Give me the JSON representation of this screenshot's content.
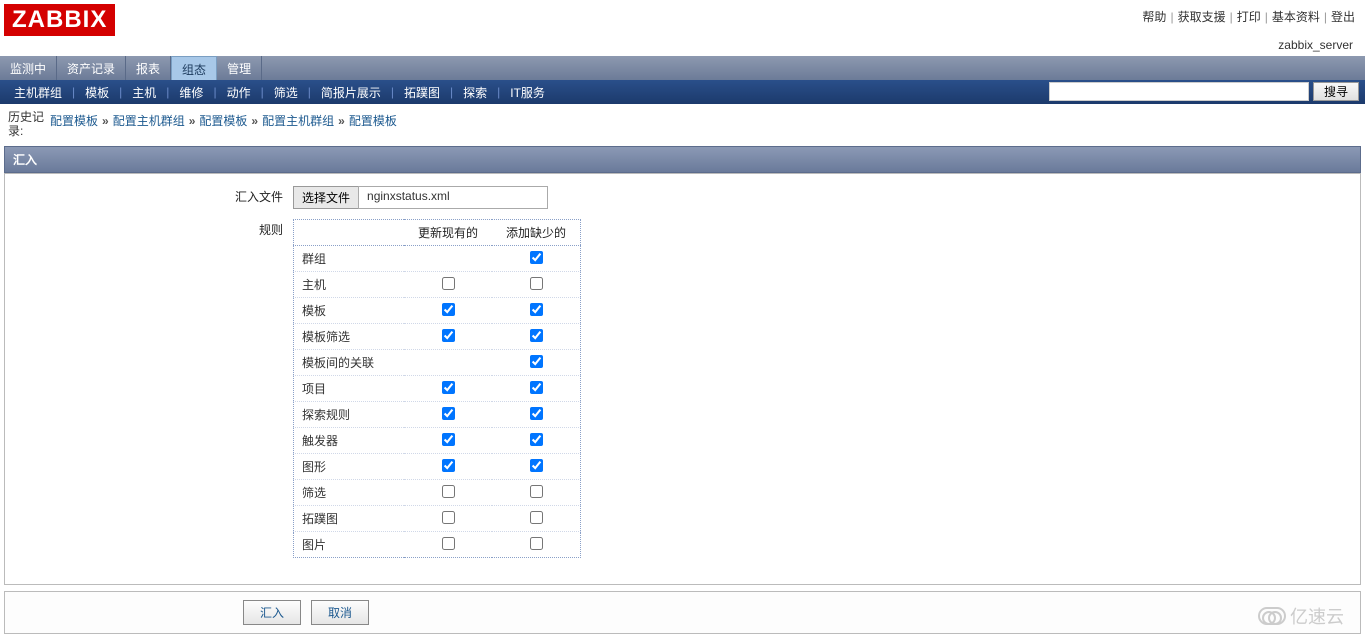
{
  "logo_text": "ZABBIX",
  "server_name": "zabbix_server",
  "top_links": [
    "帮助",
    "获取支援",
    "打印",
    "基本资料",
    "登出"
  ],
  "main_tabs": [
    "监测中",
    "资产记录",
    "报表",
    "组态",
    "管理"
  ],
  "main_tab_active_index": 3,
  "sub_tabs": [
    "主机群组",
    "模板",
    "主机",
    "维修",
    "动作",
    "筛选",
    "简报片展示",
    "拓蹼图",
    "探索",
    "IT服务"
  ],
  "search": {
    "placeholder": "",
    "button": "搜寻"
  },
  "history": {
    "label": "历史记录:",
    "items": [
      "配置模板",
      "配置主机群组",
      "配置模板",
      "配置主机群组",
      "配置模板"
    ]
  },
  "section_title": "汇入",
  "form": {
    "file_label": "汇入文件",
    "file_button": "选择文件",
    "file_name": "nginxstatus.xml",
    "rules_label": "规则",
    "col_update": "更新现有的",
    "col_add": "添加缺少的",
    "rows": [
      {
        "name": "群组",
        "update": null,
        "add": true
      },
      {
        "name": "主机",
        "update": false,
        "add": false
      },
      {
        "name": "模板",
        "update": true,
        "add": true
      },
      {
        "name": "模板筛选",
        "update": true,
        "add": true
      },
      {
        "name": "模板间的关联",
        "update": null,
        "add": true
      },
      {
        "name": "项目",
        "update": true,
        "add": true
      },
      {
        "name": "探索规则",
        "update": true,
        "add": true
      },
      {
        "name": "触发器",
        "update": true,
        "add": true
      },
      {
        "name": "图形",
        "update": true,
        "add": true
      },
      {
        "name": "筛选",
        "update": false,
        "add": false
      },
      {
        "name": "拓蹼图",
        "update": false,
        "add": false
      },
      {
        "name": "图片",
        "update": false,
        "add": false
      }
    ]
  },
  "buttons": {
    "import": "汇入",
    "cancel": "取消"
  },
  "watermark": "亿速云"
}
